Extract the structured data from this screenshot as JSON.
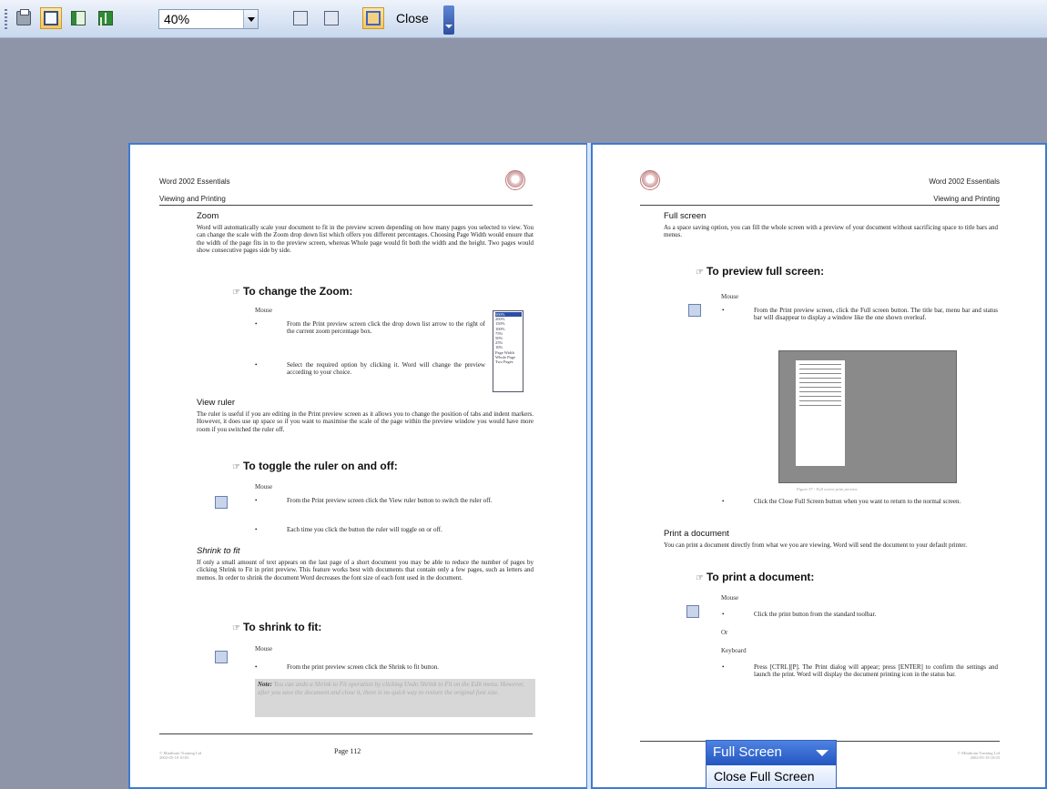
{
  "toolbar": {
    "zoom_value": "40%",
    "close_label": "Close",
    "icons": [
      "print-icon",
      "magnifier-icon",
      "one-page-icon",
      "multiple-pages-icon",
      "view-ruler-icon",
      "shrink-to-fit-icon",
      "full-screen-icon"
    ]
  },
  "left_page": {
    "header_left": "Word 2002 Essentials",
    "header_sub": "Viewing and Printing",
    "zoom_heading": "Zoom",
    "zoom_body": "Word will automatically scale your document to fit in the preview screen depending on how many pages you selected to view. You can change the scale with the Zoom drop down list which offers you different percentages. Choosing Page Width would ensure that the width of the page fits in to the preview screen, whereas Whole page would fit both the width and the height. Two pages would show consecutive pages side by side.",
    "change_zoom_heading": "To change the Zoom:",
    "mouse1": "Mouse",
    "change_zoom_b1": "From the Print preview screen click the drop down list arrow to the right of the current zoom percentage box.",
    "change_zoom_b2": "Select the required option by clicking it. Word will change the preview according to your choice.",
    "zoom_options": [
      "500%",
      "200%",
      "150%",
      "100%",
      "75%",
      "50%",
      "25%",
      "10%",
      "Page Width",
      "Whole Page",
      "Two Pages"
    ],
    "view_ruler_heading": "View ruler",
    "view_ruler_body": "The ruler is useful if you are editing in the Print preview screen as it allows you to change the position of tabs and indent markers. However, it does use up space so if you want to maximise the scale of the page within the preview window you would have more room if you switched the ruler off.",
    "toggle_ruler_heading": "To toggle the ruler on and off:",
    "mouse2": "Mouse",
    "toggle_b1": "From the Print preview screen click the View ruler button to switch the ruler off.",
    "toggle_b2": "Each time you click the button the ruler will toggle on or off.",
    "shrink_heading": "Shrink to fit",
    "shrink_body": "If only a small amount of text appears on the last page of a short document you may be able to reduce the number of pages by clicking Shrink to Fit in print preview. This feature works best with documents that contain only a few pages, such as letters and memos. In order to shrink the document Word decreases the font size of each font used in the document.",
    "shrink_fit_heading": "To shrink to fit:",
    "mouse3": "Mouse",
    "shrink_b1": "From the print preview screen click the Shrink to fit button.",
    "note_label": "Note:",
    "note_text": "You can undo a Shrink to Fit operation by clicking Undo Shrink to Fit on the Edit menu. However, after you save the document and close it, there is no quick way to restore the original font size.",
    "footer_left": "© Mindtrain Training Ltd\n2002-05-18 10:03",
    "page_number": "Page 112"
  },
  "right_page": {
    "header_right": "Word 2002 Essentials",
    "header_sub": "Viewing and Printing",
    "full_screen_heading": "Full screen",
    "full_screen_body": "As a space saving option, you can fill the whole screen with a preview of your document without sacrificing space to title bars and menus.",
    "preview_full_heading": "To preview full screen:",
    "mouse1": "Mouse",
    "preview_b1": "From the Print preview screen, click the Full screen button. The title bar, menu bar and status bar will disappear to display a window like the one shown overleaf.",
    "figure_caption": "Figure 57 - Full screen print preview",
    "preview_b2": "Click the Close Full Screen button when you want to return to the normal screen.",
    "print_heading": "Print a document",
    "print_body": "You can print a document directly from what we you are viewing. Word will send the document to your default printer.",
    "print_doc_heading": "To print a document:",
    "mouse2": "Mouse",
    "print_b1": "Click the print button from the standard toolbar.",
    "or_label": "Or",
    "keyboard_label": "Keyboard",
    "print_b2": "Press [CTRL][P]. The Print dialog will appear; press [ENTER] to confirm the settings and launch the print. Word will display the document printing icon in the status bar.",
    "footer_right": "© Mindtrain Training Ltd\n2002-05-18 10:03"
  },
  "full_screen_bar": {
    "title": "Full Screen",
    "close_label": "Close Full Screen"
  }
}
